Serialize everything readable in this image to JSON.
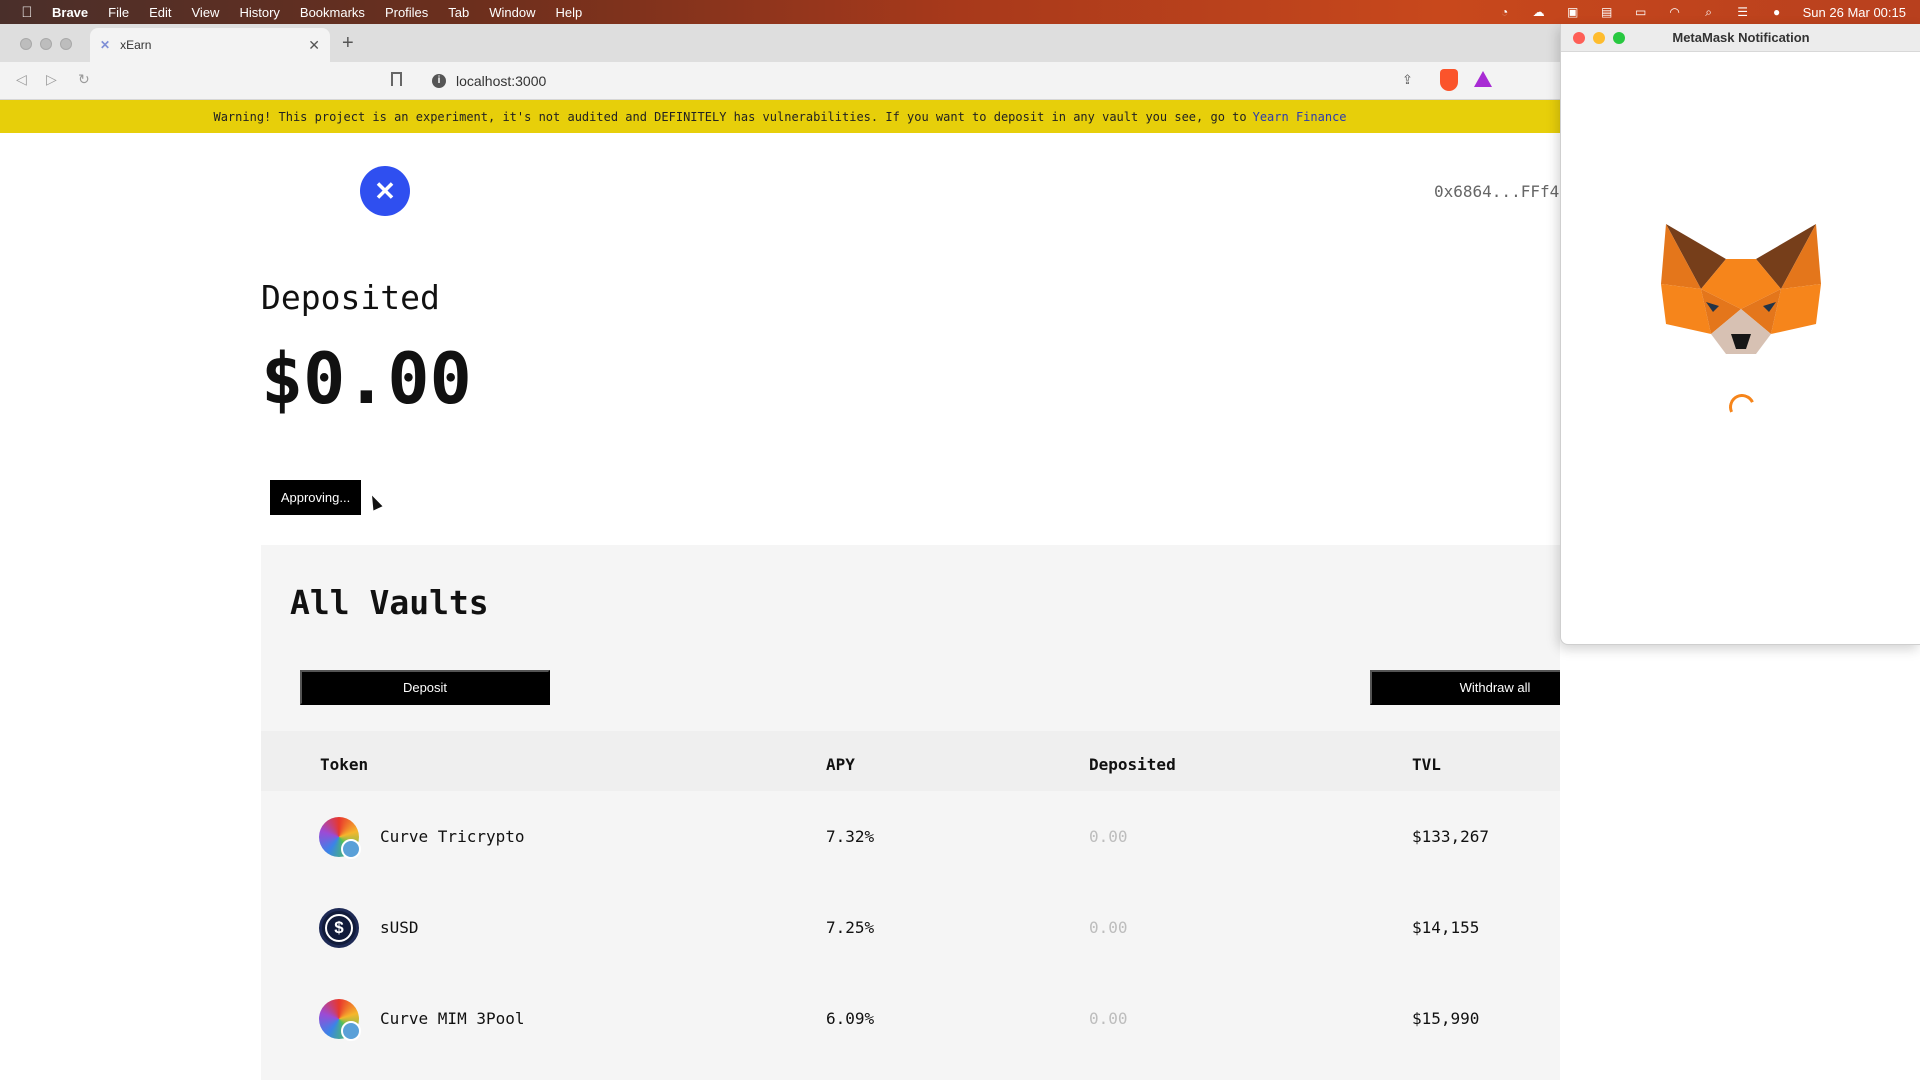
{
  "menubar": {
    "items": [
      "Brave",
      "File",
      "Edit",
      "View",
      "History",
      "Bookmarks",
      "Profiles",
      "Tab",
      "Window",
      "Help"
    ],
    "clock": "Sun 26 Mar  00:15"
  },
  "browser": {
    "tab_title": "xEarn",
    "tab_favicon": "✕",
    "url": "localhost:3000"
  },
  "warning": {
    "text": "Warning! This project is an experiment, it's not audited and DEFINITELY has vulnerabilities. If you want to deposit in any vault you see, go to",
    "link": "Yearn Finance"
  },
  "header": {
    "logo_glyph": "✕",
    "address": "0x6864...FFf4"
  },
  "summary": {
    "title": "Deposited",
    "value": "$0.00",
    "approve_button": "Approving..."
  },
  "vaults": {
    "title": "All Vaults",
    "deposit_button": "Deposit",
    "withdraw_button": "Withdraw all",
    "columns": [
      "Token",
      "APY",
      "Deposited",
      "TVL"
    ],
    "rows": [
      {
        "token": "Curve Tricrypto",
        "apy": "7.32%",
        "deposited": "0.00",
        "tvl": "$133,267",
        "icon": "curve-tricrypto-icon"
      },
      {
        "token": "sUSD",
        "apy": "7.25%",
        "deposited": "0.00",
        "tvl": "$14,155",
        "icon": "susd-icon"
      },
      {
        "token": "Curve MIM 3Pool",
        "apy": "6.09%",
        "deposited": "0.00",
        "tvl": "$15,990",
        "icon": "curve-mim-icon"
      }
    ]
  },
  "metamask": {
    "title": "MetaMask Notification"
  },
  "colors": {
    "warning_bg": "#e7cf0a",
    "logo_blue": "#2f4ff0",
    "metamask_orange": "#f6851b"
  }
}
